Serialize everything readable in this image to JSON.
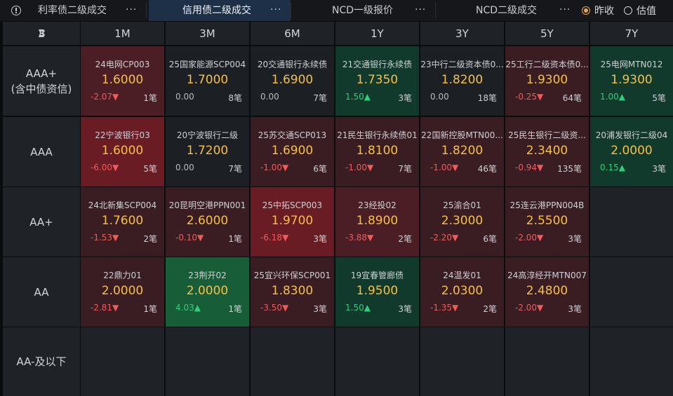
{
  "tabs": [
    {
      "label": "利率债二级成交",
      "more": "···",
      "active": false
    },
    {
      "label": "信用债二级成交",
      "more": "···",
      "active": true
    },
    {
      "label": "NCD一级报价",
      "more": "···",
      "active": false
    },
    {
      "label": "NCD二级成交",
      "more": "···",
      "active": false
    }
  ],
  "radio_options": [
    {
      "label": "昨收",
      "selected": true
    },
    {
      "label": "估值",
      "selected": false
    }
  ],
  "icons": {
    "info": "info-circle-icon",
    "corner": "brand-logo-icon"
  },
  "colors": {
    "rate": "#f5c04a",
    "down": "#ef5b5b",
    "up": "#2ed07a",
    "active_tab": "#1d3047"
  },
  "columns": [
    "1M",
    "3M",
    "6M",
    "1Y",
    "3Y",
    "5Y",
    "7Y"
  ],
  "rows": [
    {
      "label_line1": "AAA+",
      "label_line2": "(含中债资信)"
    },
    {
      "label_line1": "AAA",
      "label_line2": ""
    },
    {
      "label_line1": "AA+",
      "label_line2": ""
    },
    {
      "label_line1": "AA",
      "label_line2": ""
    },
    {
      "label_line1": "AA-及以下",
      "label_line2": ""
    }
  ],
  "cells": [
    [
      {
        "name": "24电网CP003",
        "rate": "1.6000",
        "change": "-2.07▼",
        "count": "1笔",
        "dir": "down",
        "shade": "red2"
      },
      {
        "name": "25国家能源SCP004",
        "rate": "1.7000",
        "change": "0.00",
        "count": "8笔",
        "dir": "flat",
        "shade": "neutral"
      },
      {
        "name": "20交通银行永续债",
        "rate": "1.6900",
        "change": "0.00",
        "count": "7笔",
        "dir": "flat",
        "shade": "neutral"
      },
      {
        "name": "21交通银行永续债",
        "rate": "1.7350",
        "change": "1.50▲",
        "count": "3笔",
        "dir": "up",
        "shade": "green1"
      },
      {
        "name": "23中行二级资本债0...",
        "rate": "1.8200",
        "change": "0.00",
        "count": "18笔",
        "dir": "flat",
        "shade": "neutral"
      },
      {
        "name": "25工行二级资本债0...",
        "rate": "1.9300",
        "change": "-0.25▼",
        "count": "64笔",
        "dir": "down",
        "shade": "red1"
      },
      {
        "name": "25电网MTN012",
        "rate": "1.9300",
        "change": "1.00▲",
        "count": "5笔",
        "dir": "up",
        "shade": "green1"
      }
    ],
    [
      {
        "name": "22宁波银行03",
        "rate": "1.6000",
        "change": "-6.00▼",
        "count": "5笔",
        "dir": "down",
        "shade": "red3"
      },
      {
        "name": "20宁波银行二级",
        "rate": "1.7200",
        "change": "0.00",
        "count": "7笔",
        "dir": "flat",
        "shade": "neutral"
      },
      {
        "name": "25苏交通SCP013",
        "rate": "1.6900",
        "change": "-1.00▼",
        "count": "6笔",
        "dir": "down",
        "shade": "red1"
      },
      {
        "name": "21民生银行永续债01",
        "rate": "1.8100",
        "change": "-1.00▼",
        "count": "7笔",
        "dir": "down",
        "shade": "red1"
      },
      {
        "name": "22国新控股MTN00...",
        "rate": "1.8200",
        "change": "-1.00▼",
        "count": "46笔",
        "dir": "down",
        "shade": "red1"
      },
      {
        "name": "25民生银行二级资...",
        "rate": "2.3400",
        "change": "-0.94▼",
        "count": "135笔",
        "dir": "down",
        "shade": "red1"
      },
      {
        "name": "20浦发银行二级04",
        "rate": "2.0000",
        "change": "0.15▲",
        "count": "3笔",
        "dir": "up",
        "shade": "green1"
      }
    ],
    [
      {
        "name": "24北新集SCP004",
        "rate": "1.7600",
        "change": "-1.53▼",
        "count": "2笔",
        "dir": "down",
        "shade": "red1"
      },
      {
        "name": "20昆明空港PPN001",
        "rate": "2.6000",
        "change": "-0.10▼",
        "count": "1笔",
        "dir": "down",
        "shade": "red1"
      },
      {
        "name": "25中拓SCP003",
        "rate": "1.9700",
        "change": "-6.18▼",
        "count": "3笔",
        "dir": "down",
        "shade": "red3"
      },
      {
        "name": "23经投02",
        "rate": "1.8900",
        "change": "-3.88▼",
        "count": "2笔",
        "dir": "down",
        "shade": "red2"
      },
      {
        "name": "25渝合01",
        "rate": "2.3000",
        "change": "-2.20▼",
        "count": "6笔",
        "dir": "down",
        "shade": "red1"
      },
      {
        "name": "25连云港PPN004B",
        "rate": "2.5500",
        "change": "-2.00▼",
        "count": "3笔",
        "dir": "down",
        "shade": "red1"
      },
      null
    ],
    [
      {
        "name": "22鼎力01",
        "rate": "2.0000",
        "change": "-2.81▼",
        "count": "1笔",
        "dir": "down",
        "shade": "red1"
      },
      {
        "name": "23荆开02",
        "rate": "2.0000",
        "change": "4.03▲",
        "count": "1笔",
        "dir": "up",
        "shade": "green2"
      },
      {
        "name": "25宜兴环保SCP001",
        "rate": "1.8300",
        "change": "-3.50▼",
        "count": "3笔",
        "dir": "down",
        "shade": "red1"
      },
      {
        "name": "19宜春管廊债",
        "rate": "1.9500",
        "change": "1.50▲",
        "count": "3笔",
        "dir": "up",
        "shade": "green1"
      },
      {
        "name": "24温发01",
        "rate": "2.0300",
        "change": "-1.35▼",
        "count": "2笔",
        "dir": "down",
        "shade": "red1"
      },
      {
        "name": "24高淳经开MTN007",
        "rate": "2.4800",
        "change": "-2.00▼",
        "count": "3笔",
        "dir": "down",
        "shade": "red1"
      },
      null
    ],
    [
      null,
      null,
      null,
      null,
      null,
      null,
      null
    ]
  ]
}
